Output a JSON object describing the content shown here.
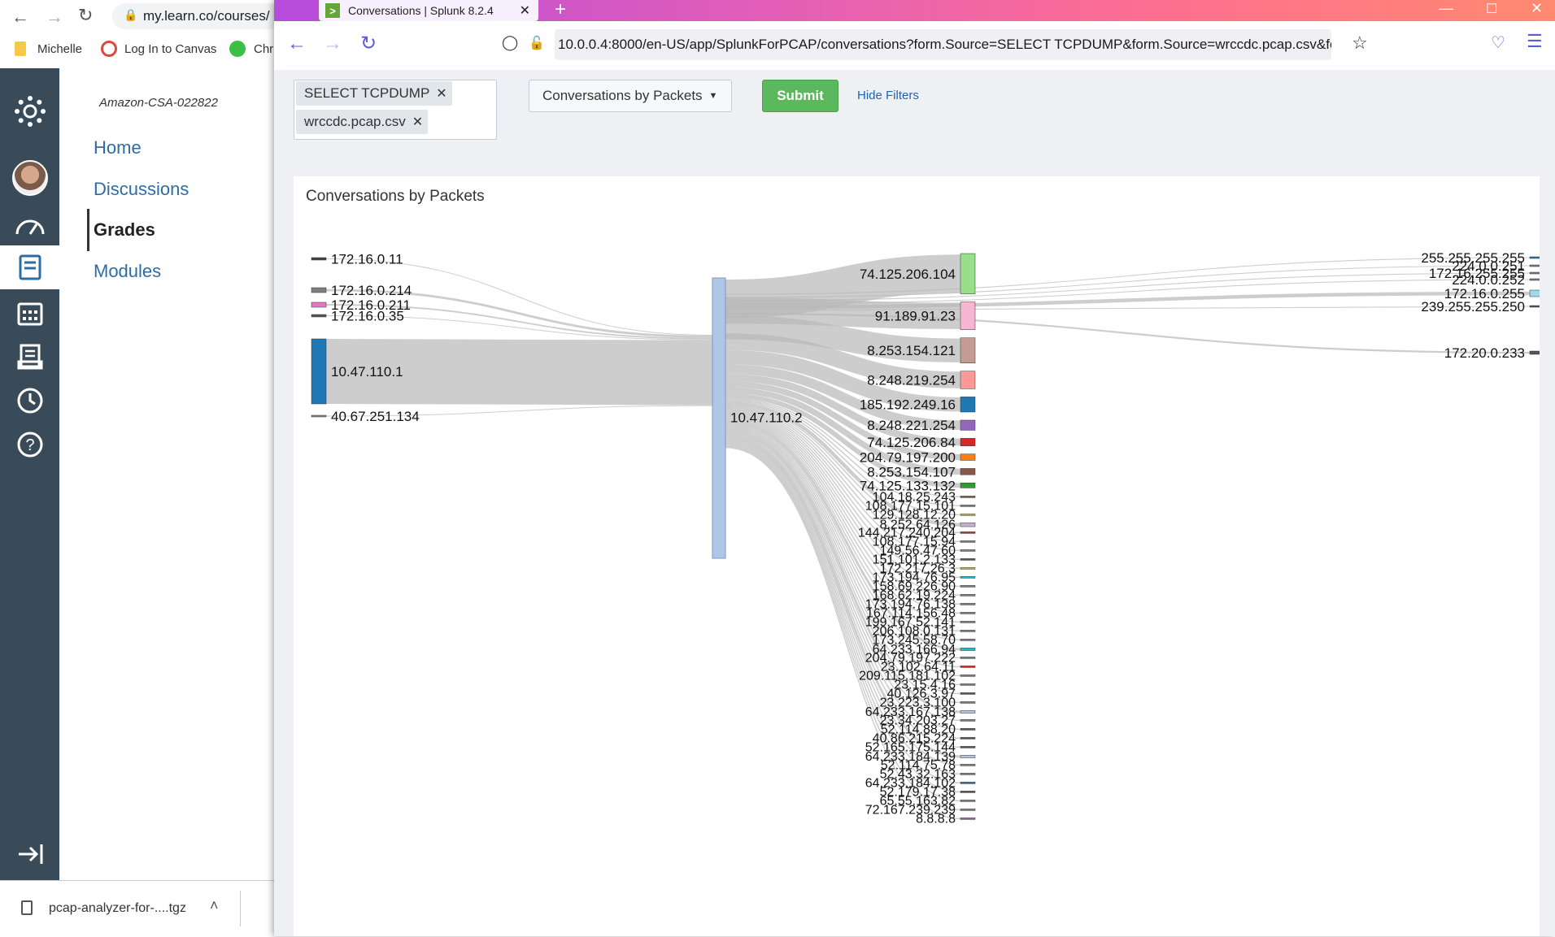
{
  "background_browser": {
    "url_text": "my.learn.co/courses/",
    "bookmarks": [
      "Michelle",
      "Log In to Canvas",
      "Chr"
    ]
  },
  "canvas": {
    "account_name": "Amazon-CSA-022822",
    "nav": [
      "Home",
      "Discussions",
      "Grades",
      "Modules"
    ],
    "active_nav": "Grades",
    "download_file": "pcap-analyzer-for-....tgz"
  },
  "window": {
    "tab_title": "Conversations | Splunk 8.2.4",
    "url": "10.0.0.4:8000/en-US/app/SplunkForPCAP/conversations?form.Source=SELECT TCPDUMP&form.Source=wrccdc.pcap.csv&form.c"
  },
  "filters": {
    "source_chips": [
      "SELECT TCPDUMP",
      "wrccdc.pcap.csv"
    ],
    "view_dropdown": "Conversations by Packets",
    "submit_label": "Submit",
    "hide_filters_label": "Hide Filters"
  },
  "panel": {
    "title": "Conversations by Packets"
  },
  "chart_data": {
    "type": "sankey",
    "hub": "10.47.110.2",
    "sources": [
      {
        "label": "172.16.0.11",
        "value": 1,
        "color": "#444444"
      },
      {
        "label": "172.16.0.214",
        "value": 3,
        "color": "#7f7f7f"
      },
      {
        "label": "172.16.0.211",
        "value": 2,
        "color": "#e377c2"
      },
      {
        "label": "172.16.0.35",
        "value": 1,
        "color": "#555555"
      },
      {
        "label": "10.47.110.1",
        "value": 85,
        "color": "#1f77b4"
      },
      {
        "label": "40.67.251.134",
        "value": 0.5,
        "color": "#888888"
      }
    ],
    "destinations": [
      {
        "label": "74.125.206.104",
        "value": 16,
        "color": "#98df8a"
      },
      {
        "label": "91.189.91.23",
        "value": 11,
        "color": "#f7b6d2"
      },
      {
        "label": "8.253.154.121",
        "value": 10,
        "color": "#c49c94"
      },
      {
        "label": "8.248.219.254",
        "value": 7,
        "color": "#ff9896"
      },
      {
        "label": "185.192.249.16",
        "value": 6,
        "color": "#1f77b4"
      },
      {
        "label": "8.248.221.254",
        "value": 4,
        "color": "#9467bd"
      },
      {
        "label": "74.125.206.84",
        "value": 3,
        "color": "#d62728"
      },
      {
        "label": "204.79.197.200",
        "value": 2.5,
        "color": "#ff7f0e"
      },
      {
        "label": "8.253.154.107",
        "value": 2.5,
        "color": "#8c564b"
      },
      {
        "label": "74.125.133.132",
        "value": 2,
        "color": "#2ca02c"
      },
      {
        "label": "104.18.25.243",
        "value": 0.5,
        "color": "#8c564b"
      },
      {
        "label": "108.177.15.101",
        "value": 0.5,
        "color": "#7f7f7f"
      },
      {
        "label": "129.128.12.20",
        "value": 0.5,
        "color": "#bcbd22"
      },
      {
        "label": "8.252.64.126",
        "value": 1.5,
        "color": "#c5b0d5"
      },
      {
        "label": "144.217.240.204",
        "value": 0.5,
        "color": "#d62728"
      },
      {
        "label": "108.177.15.94",
        "value": 0.5,
        "color": "#7f7f7f"
      },
      {
        "label": "149.56.47.60",
        "value": 0.5,
        "color": "#7f7f7f"
      },
      {
        "label": "151.101.2.133",
        "value": 0.5,
        "color": "#555555"
      },
      {
        "label": "172.217.26.3",
        "value": 0.5,
        "color": "#bcbd22"
      },
      {
        "label": "173.194.76.95",
        "value": 0.5,
        "color": "#17becf"
      },
      {
        "label": "158.69.226.90",
        "value": 0.5,
        "color": "#7f7f7f"
      },
      {
        "label": "168.62.19.224",
        "value": 0.5,
        "color": "#7f7f7f"
      },
      {
        "label": "173.194.76.138",
        "value": 0.5,
        "color": "#7f7f7f"
      },
      {
        "label": "167.114.156.48",
        "value": 0.5,
        "color": "#7f7f7f"
      },
      {
        "label": "199.167.52.141",
        "value": 0.5,
        "color": "#7f7f7f"
      },
      {
        "label": "206.108.0.131",
        "value": 0.5,
        "color": "#7f7f7f"
      },
      {
        "label": "173.245.58.70",
        "value": 0.5,
        "color": "#7f7f7f"
      },
      {
        "label": "64.233.166.94",
        "value": 1,
        "color": "#17becf"
      },
      {
        "label": "204.79.197.222",
        "value": 0.5,
        "color": "#7f7f7f"
      },
      {
        "label": "23.102.64.11",
        "value": 0.5,
        "color": "#d62728"
      },
      {
        "label": "209.115.181.102",
        "value": 0.5,
        "color": "#7f7f7f"
      },
      {
        "label": "23.15.4.16",
        "value": 0.5,
        "color": "#7f7f7f"
      },
      {
        "label": "40.126.3.97",
        "value": 0.5,
        "color": "#555555"
      },
      {
        "label": "23.223.3.100",
        "value": 0.5,
        "color": "#7f7f7f"
      },
      {
        "label": "64.233.167.138",
        "value": 1,
        "color": "#aec7e8"
      },
      {
        "label": "23.34.203.27",
        "value": 0.5,
        "color": "#7f7f7f"
      },
      {
        "label": "52.114.88.20",
        "value": 0.5,
        "color": "#555555"
      },
      {
        "label": "40.86.215.224",
        "value": 0.5,
        "color": "#555555"
      },
      {
        "label": "52.165.175.144",
        "value": 0.5,
        "color": "#555555"
      },
      {
        "label": "64.233.184.139",
        "value": 1,
        "color": "#aec7e8"
      },
      {
        "label": "52.114.75.78",
        "value": 0.5,
        "color": "#7f7f7f"
      },
      {
        "label": "52.43.32.163",
        "value": 0.5,
        "color": "#7f7f7f"
      },
      {
        "label": "64.233.184.102",
        "value": 0.5,
        "color": "#1f77b4"
      },
      {
        "label": "52.179.17.38",
        "value": 0.5,
        "color": "#555555"
      },
      {
        "label": "65.55.163.82",
        "value": 0.5,
        "color": "#7f7f7f"
      },
      {
        "label": "72.167.239.239",
        "value": 0.5,
        "color": "#7f7f7f"
      },
      {
        "label": "8.8.8.8",
        "value": 0.5,
        "color": "#9467bd"
      }
    ],
    "far_right": [
      {
        "label": "255.255.255.255",
        "value": 0.5,
        "color": "#1f77b4"
      },
      {
        "label": "224.0.0.251",
        "value": 0.5,
        "color": "#7f7f7f"
      },
      {
        "label": "172.16.255.255",
        "value": 0.5,
        "color": "#7f7f7f"
      },
      {
        "label": "224.0.0.252",
        "value": 0.5,
        "color": "#7f7f7f"
      },
      {
        "label": "172.16.0.255",
        "value": 2,
        "color": "#9edae5"
      },
      {
        "label": "239.255.255.250",
        "value": 0.5,
        "color": "#555555"
      },
      {
        "label": "172.20.0.233",
        "value": 1,
        "color": "#555555"
      }
    ]
  }
}
